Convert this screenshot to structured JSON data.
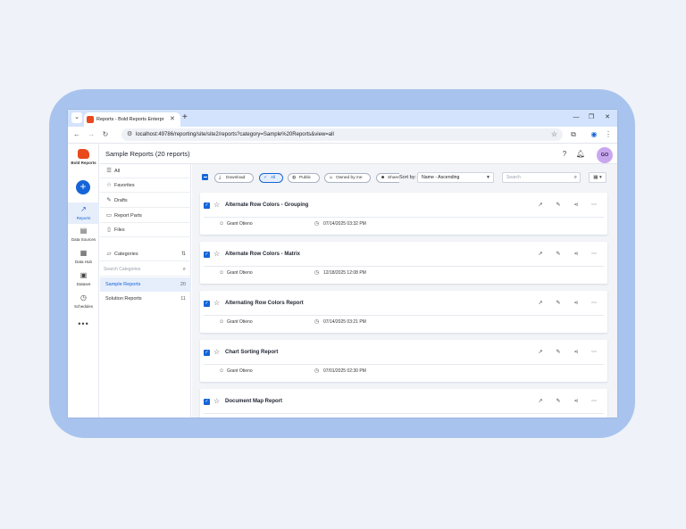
{
  "browser": {
    "tab_title": "Reports - Bold Reports Enterpr",
    "tab_close": "✕",
    "new_tab": "+",
    "url": "localhost:49786/reporting/site/site2/reports?category=Sample%20Reports&view=all"
  },
  "nav": {
    "brand": "Bold Reports",
    "create": "+",
    "items": [
      {
        "label": "Reports",
        "icon": "trending-up-icon"
      },
      {
        "label": "Data Sources",
        "icon": "data-source-icon"
      },
      {
        "label": "Data Hub",
        "icon": "data-hub-icon"
      },
      {
        "label": "Dataset",
        "icon": "dataset-icon"
      },
      {
        "label": "Schedules",
        "icon": "schedule-icon"
      }
    ],
    "more": "•••"
  },
  "header": {
    "title": "Sample Reports (20 reports)",
    "avatar": "GO"
  },
  "categories": {
    "filters": [
      {
        "label": "All",
        "icon": "list-icon"
      },
      {
        "label": "Favorites",
        "icon": "star-icon"
      },
      {
        "label": "Drafts",
        "icon": "draft-icon"
      },
      {
        "label": "Report Parts",
        "icon": "report-parts-icon"
      },
      {
        "label": "Files",
        "icon": "file-icon"
      },
      {
        "label": "Categories",
        "icon": "folder-icon"
      }
    ],
    "search_placeholder": "Search Categories",
    "items": [
      {
        "label": "Sample Reports",
        "count": "20"
      },
      {
        "label": "Solution Reports",
        "count": "11"
      }
    ]
  },
  "toolbar": {
    "download": "Download",
    "chips": [
      "All",
      "Public",
      "Owned by me",
      "Shared with"
    ],
    "sort_label": "Sort by:",
    "sort_value": "Name - Ascending",
    "search_placeholder": "Search"
  },
  "reports": [
    {
      "title": "Alternate Row Colors - Grouping",
      "owner": "Grant Otieno",
      "date": "07/14/2025 03:32 PM"
    },
    {
      "title": "Alternate Row Colors - Matrix",
      "owner": "Grant Otieno",
      "date": "12/18/2025 12:08 PM"
    },
    {
      "title": "Alternating Row Colors Report",
      "owner": "Grant Otieno",
      "date": "07/14/2025 03:21 PM"
    },
    {
      "title": "Chart Sorting Report",
      "owner": "Grant Otieno",
      "date": "07/01/2025 02:30 PM"
    },
    {
      "title": "Document Map Report",
      "owner": "",
      "date": ""
    }
  ],
  "colors": {
    "accent": "#1565d8",
    "brand": "#e8491d",
    "frame": "#a8c4ee",
    "tabstrip": "#d3e3fd"
  }
}
